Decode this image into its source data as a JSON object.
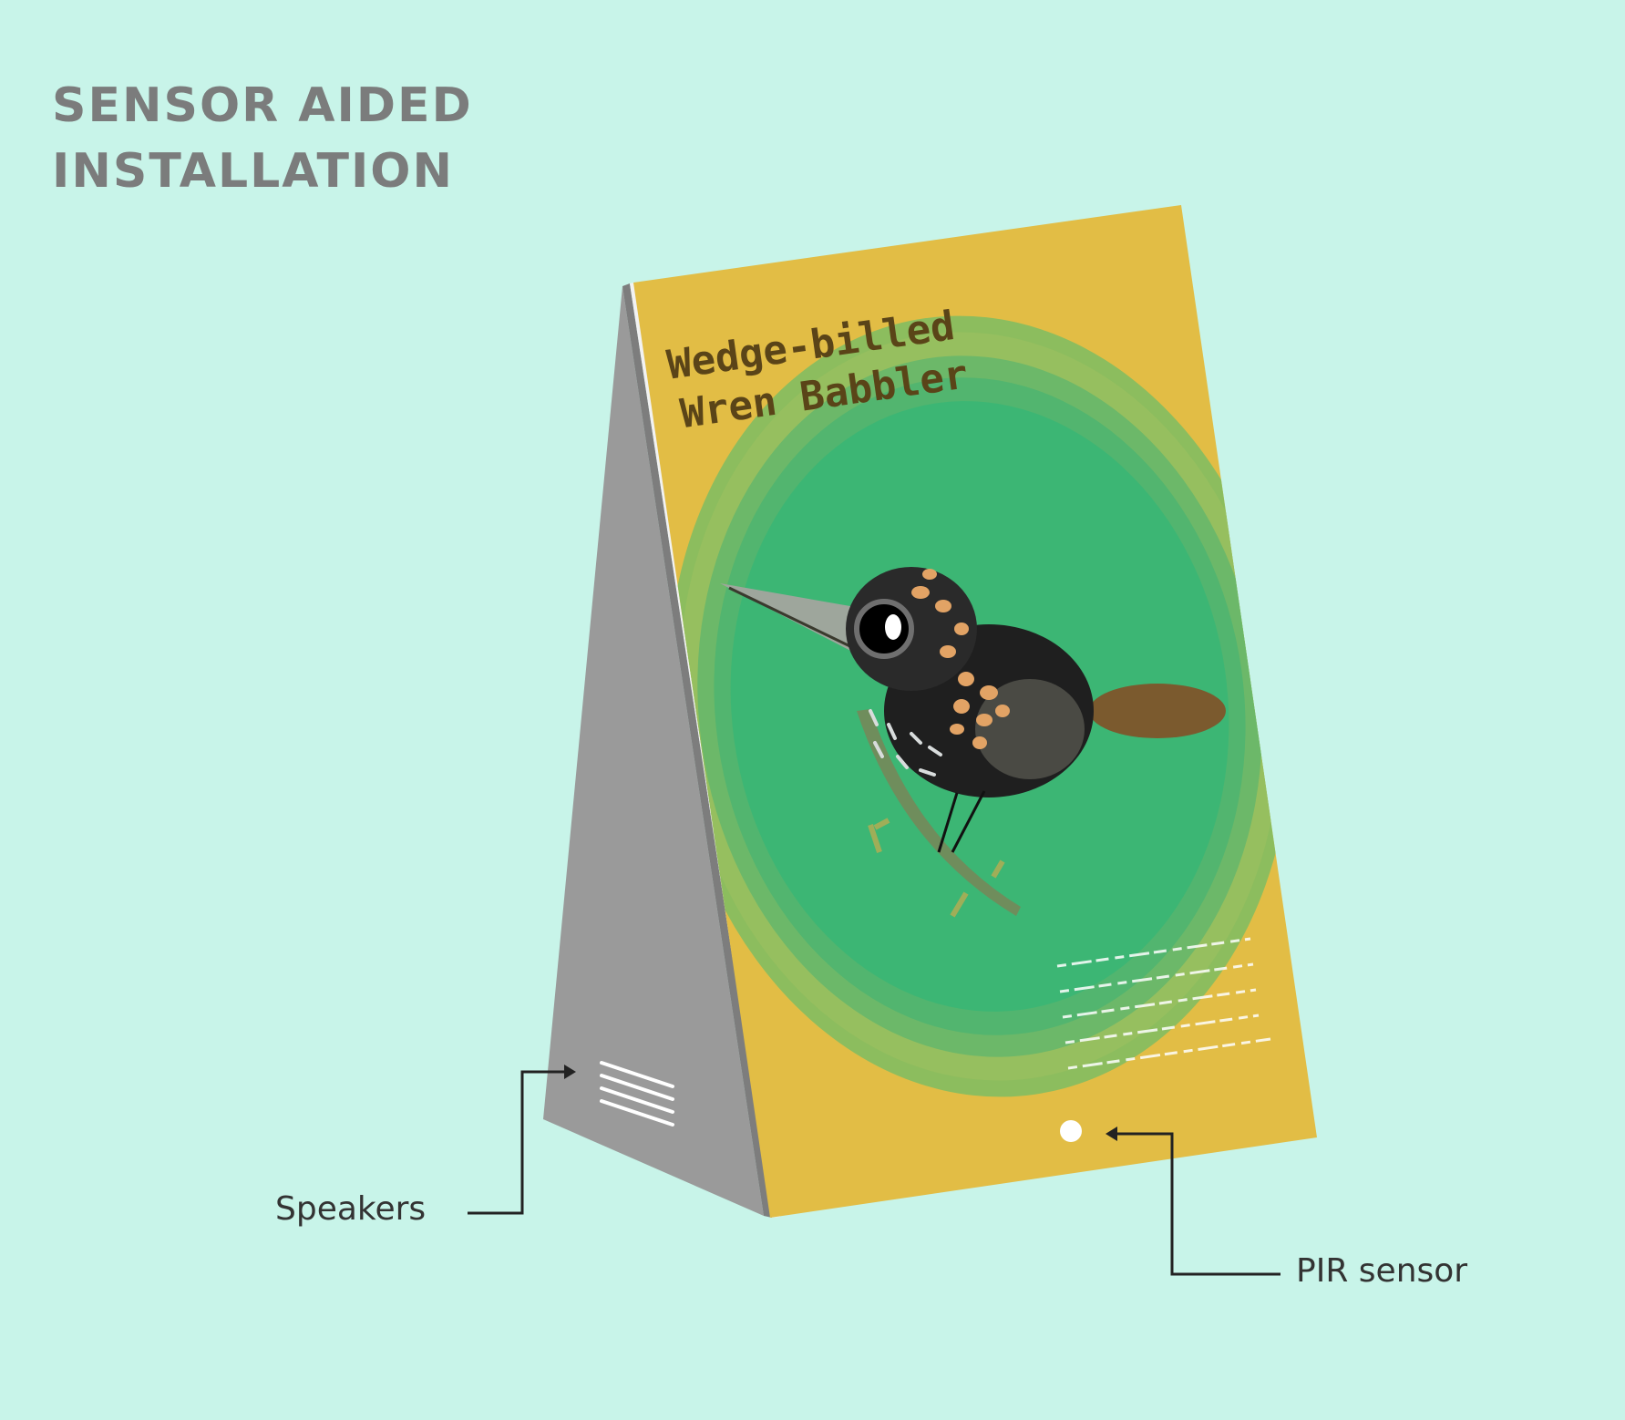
{
  "heading": {
    "line1": "SENSOR AIDED",
    "line2": "INSTALLATION"
  },
  "panel": {
    "title_line1": "Wedge-billed",
    "title_line2": "Wren Babbler"
  },
  "callouts": {
    "speakers": "Speakers",
    "pir": "PIR sensor"
  },
  "colors": {
    "background": "#c8f4e9",
    "panel": "#e2bd45",
    "circle_inner": "#3cb674",
    "side": "#9a9a9a"
  }
}
